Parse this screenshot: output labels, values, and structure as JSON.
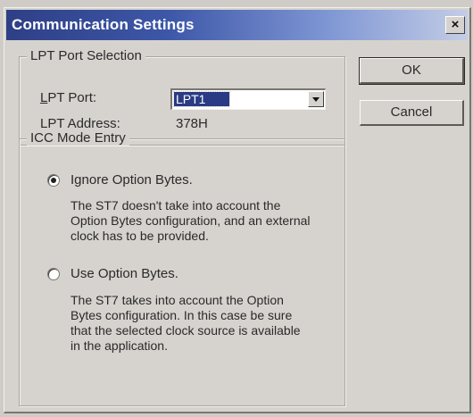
{
  "window": {
    "title": "Communication Settings",
    "close_label": "×"
  },
  "lpt_group": {
    "title": "LPT Port Selection",
    "port_label_first": "L",
    "port_label_rest": "PT Port:",
    "port_value": "LPT1",
    "address_label": "LPT Address:",
    "address_value": "378H"
  },
  "buttons": {
    "ok": "OK",
    "cancel": "Cancel"
  },
  "icc_group": {
    "title": "ICC Mode Entry",
    "option1": {
      "label": "Ignore Option Bytes.",
      "selected": true,
      "desc_line1": "The ST7 doesn't take into account the",
      "desc_line2": "Option Bytes configuration, and an external",
      "desc_line3": "clock has to be provided."
    },
    "option2": {
      "label": "Use Option Bytes.",
      "selected": false,
      "desc_line1": "The ST7 takes into account the Option",
      "desc_line2": "Bytes configuration. In this case be sure",
      "desc_line3": "that the selected clock source is available",
      "desc_line4": "in the application."
    }
  },
  "colors": {
    "titlebar_start": "#2e3f86",
    "titlebar_end": "#c4cde6",
    "dialog_bg": "#d6d3ce",
    "selection": "#2a3a84"
  }
}
